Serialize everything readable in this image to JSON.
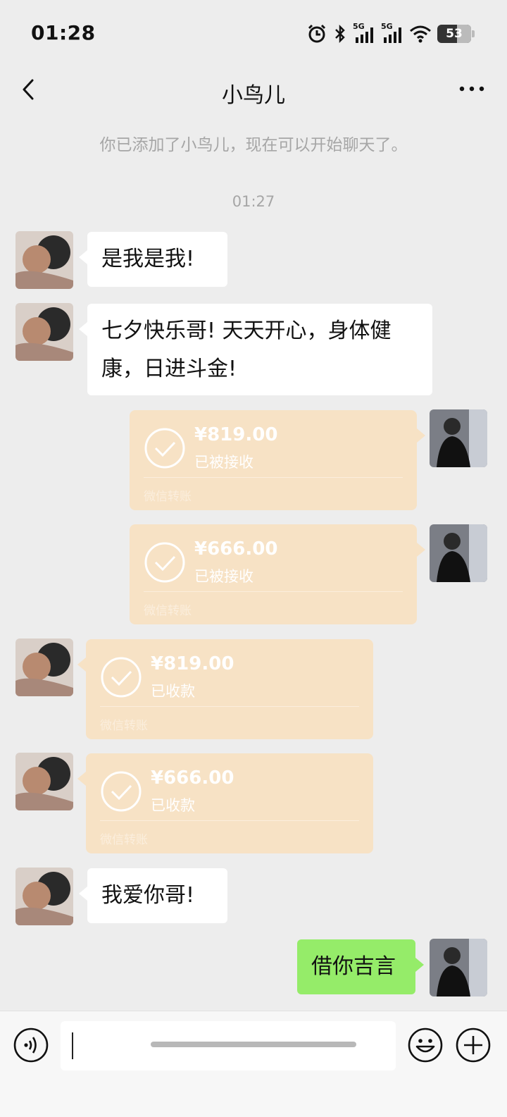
{
  "status_bar": {
    "time": "01:28",
    "network_1": "5G",
    "network_2": "5G",
    "battery": "53"
  },
  "header": {
    "title": "小鸟儿"
  },
  "system_message": "你已添加了小鸟儿，现在可以开始聊天了。",
  "timestamp": "01:27",
  "messages": [
    {
      "text": "是我是我!"
    },
    {
      "text": "七夕快乐哥! 天天开心，身体健康，日进斗金!"
    },
    {
      "amount": "¥819.00",
      "status": "已被接收",
      "label": "微信转账"
    },
    {
      "amount": "¥666.00",
      "status": "已被接收",
      "label": "微信转账"
    },
    {
      "amount": "¥819.00",
      "status": "已收款",
      "label": "微信转账"
    },
    {
      "amount": "¥666.00",
      "status": "已收款",
      "label": "微信转账"
    },
    {
      "text": "我爱你哥!"
    },
    {
      "text": "借你吉言"
    }
  ],
  "colors": {
    "transfer_bg": "#f7e2c5",
    "own_bubble": "#95ec69",
    "background": "#ededed"
  },
  "icons": {
    "back": "chevron-left-icon",
    "more": "more-dots-icon",
    "voice": "voice-icon",
    "emoji": "emoji-icon",
    "plus": "plus-icon",
    "check": "check-circle-icon"
  }
}
